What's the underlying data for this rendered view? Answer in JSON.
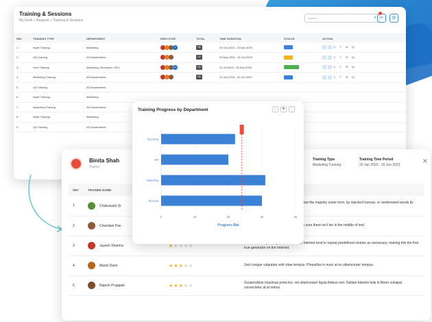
{
  "main": {
    "title": "Training & Sessions",
    "breadcrumb": "My Desk  »  Request  »  Training & Sessions",
    "search_placeholder": "Search...",
    "columns": [
      "SR#",
      "TRAINING TYPE",
      "DEPARTMENT",
      "EMPLOYEE",
      "TOTAL",
      "TIME DURATION",
      "STATUS",
      "ACTION"
    ],
    "rows": [
      {
        "sr": "1",
        "type": "Node Training",
        "dept": "Marketing",
        "total": "06",
        "duration": "20 Oct 2023 - 23 Nov 2023",
        "status": "#3b82d6",
        "extra": "3"
      },
      {
        "sr": "2",
        "type": "QA Training",
        "dept": "All Departments",
        "total": "12",
        "duration": "09 Aug 2023 - 16 Oct 2023",
        "status": "#f0b429",
        "extra": ""
      },
      {
        "sr": "3",
        "type": "Hrml Training",
        "dept": "Marketing, Developer, SEO",
        "total": "09",
        "duration": "31 Jul 2023 - 25 Sep 2023",
        "status": "#4caf50",
        "extra": "12+"
      },
      {
        "sr": "4",
        "type": "Marketing Training",
        "dept": "All Departments",
        "total": "05",
        "duration": "20 Jan 2023 - 20 Jun 2023",
        "status": "#3b82d6",
        "extra": ""
      },
      {
        "sr": "5",
        "type": "QA Training",
        "dept": "All Departments",
        "total": "",
        "duration": "",
        "status": "",
        "extra": ""
      },
      {
        "sr": "6",
        "type": "Node Training",
        "dept": "Marketing",
        "total": "",
        "duration": "",
        "status": "",
        "extra": ""
      },
      {
        "sr": "7",
        "type": "Marketing Training",
        "dept": "All Departments",
        "total": "",
        "duration": "",
        "status": "",
        "extra": ""
      },
      {
        "sr": "8",
        "type": "Node Training",
        "dept": "Marketing",
        "total": "",
        "duration": "",
        "status": "",
        "extra": ""
      },
      {
        "sr": "9",
        "type": "QA Training",
        "dept": "All Departments",
        "total": "",
        "duration": "",
        "status": "",
        "extra": ""
      }
    ]
  },
  "chart_panel": {
    "title": "Training Progress by Department"
  },
  "chart_data": {
    "type": "bar",
    "orientation": "horizontal",
    "categories": [
      "Technical",
      "HR",
      "Marketing",
      "Account"
    ],
    "values": [
      22,
      20,
      31,
      30
    ],
    "xlabel": "Progress Bar",
    "xlim": [
      0,
      30
    ],
    "xticks": [
      "0",
      "10",
      "20",
      "30",
      "40"
    ],
    "bar_color": "#3b82d6",
    "marker": {
      "value": 24,
      "color": "#e74c3c"
    }
  },
  "trainee": {
    "name": "Binita Shah",
    "role": "Trainer",
    "type_label": "Training Type",
    "type_value": "Marketing Training",
    "period_label": "Training Time Period",
    "period_value": "20 Jan 2023 - 20 Jun 2023",
    "columns": [
      "SR#",
      "TRAINEE NAME",
      "",
      "REMARKS"
    ],
    "rows": [
      {
        "sr": "1",
        "name": "Chakravarti Si",
        "rating": 0,
        "remarks": "of passages of Lorem Ipsum available, but the majority some form, by injected humour, or randomised words tly believable."
      },
      {
        "sr": "2",
        "name": "Chandani Pan",
        "rating": 0,
        "remarks": "assage of Lorem Ipsum, you need to be sure there isn't len in the middle of text."
      },
      {
        "sr": "3",
        "name": "Jayesh Sharma",
        "rating": 1,
        "remarks": "All the Lorem Ipsum generators on the Internet tend to repeat predefined chunks as necessary, making this the first true generator on the Internet."
      },
      {
        "sr": "4",
        "name": "Mansi Dave",
        "rating": 3,
        "remarks": "Sed congue vulputate velit vitae tempus. Phasellus in nunc at ex ullamcorper tempus."
      },
      {
        "sr": "5",
        "name": "Rajesh Prajapati",
        "rating": 3,
        "remarks": "Suspendisse maximus porta leo, vel ullamcorper ligula finibus non. Nullam lobortis felis in libero volutpat consectetur at at metus."
      }
    ]
  }
}
